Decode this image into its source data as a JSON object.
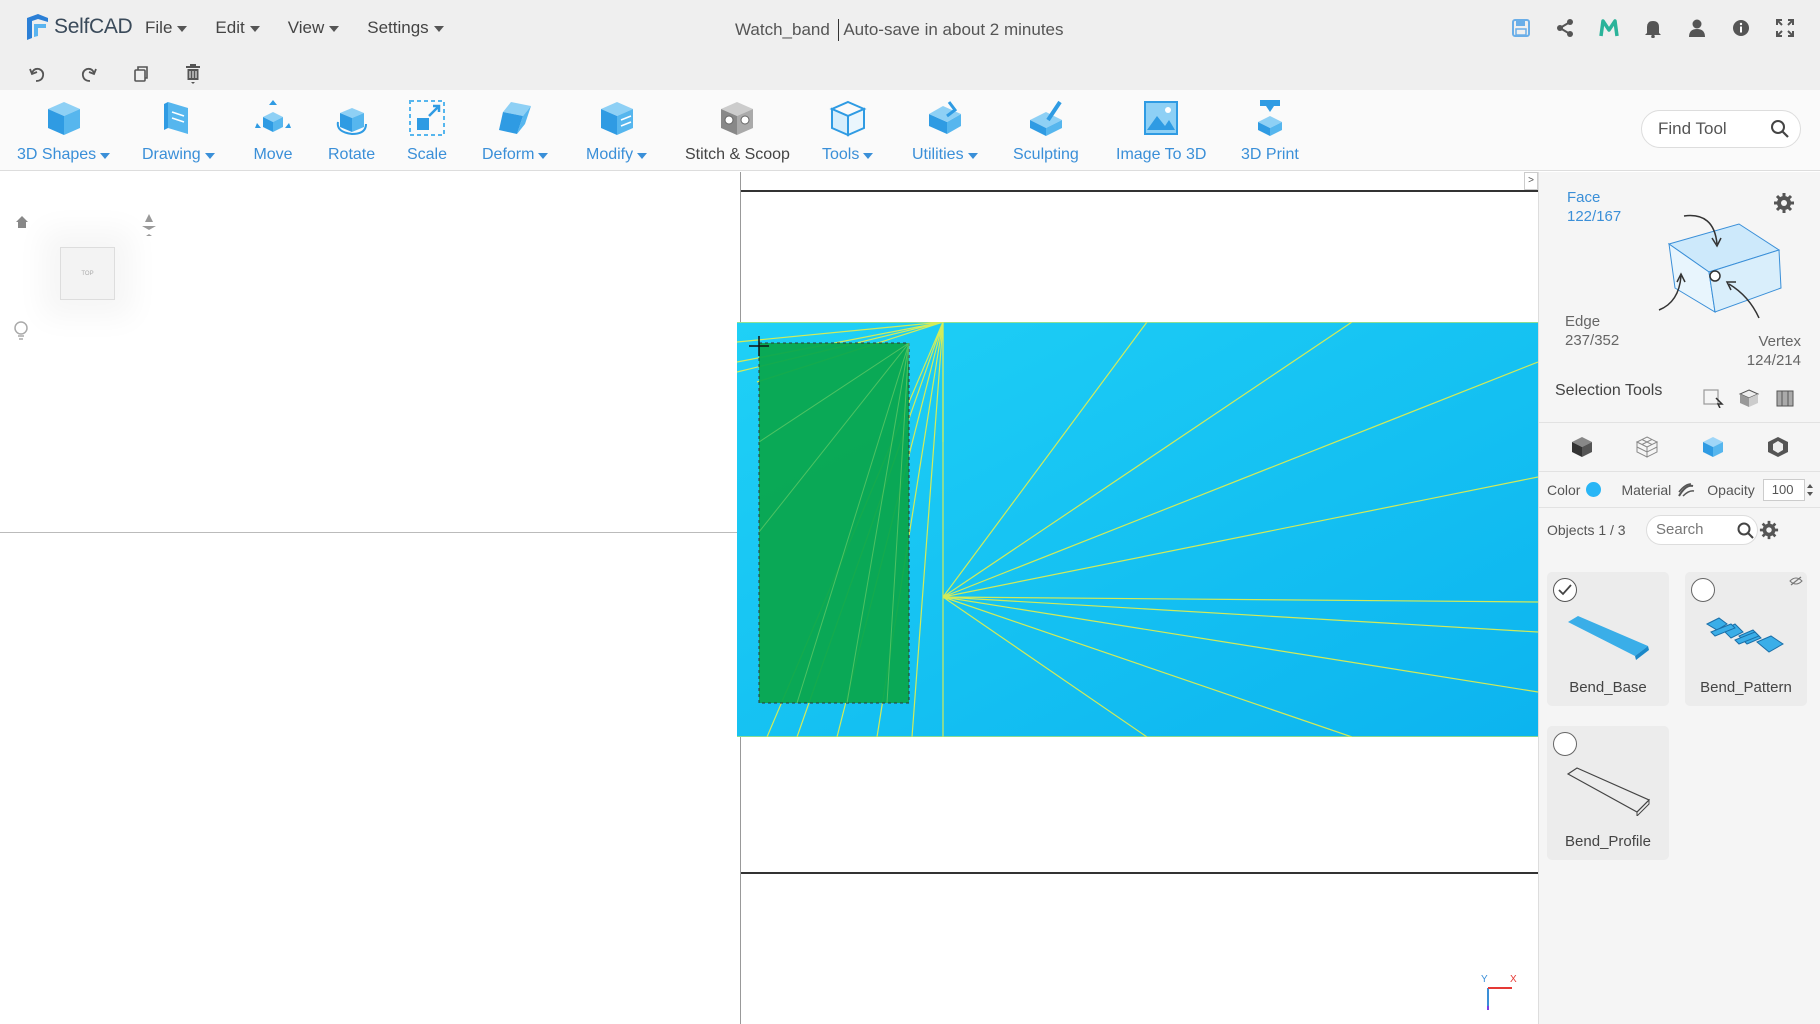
{
  "app": {
    "name": "SelfCAD",
    "menu": [
      "File",
      "Edit",
      "View",
      "Settings"
    ],
    "document_name": "Watch_band",
    "autosave_status": "Auto-save in about 2 minutes"
  },
  "topbar_icons": [
    "save-icon",
    "share-icon",
    "m-logo-icon",
    "bell-icon",
    "user-icon",
    "info-icon",
    "fullscreen-icon"
  ],
  "undo_row": [
    "undo-icon",
    "redo-icon",
    "copy-icon",
    "delete-icon"
  ],
  "toolbar": {
    "tools": [
      {
        "label": "3D Shapes",
        "dropdown": true
      },
      {
        "label": "Drawing",
        "dropdown": true
      },
      {
        "label": "Move",
        "dropdown": false
      },
      {
        "label": "Rotate",
        "dropdown": false
      },
      {
        "label": "Scale",
        "dropdown": false
      },
      {
        "label": "Deform",
        "dropdown": true
      },
      {
        "label": "Modify",
        "dropdown": true
      },
      {
        "label": "Stitch & Scoop",
        "dropdown": false
      },
      {
        "label": "Tools",
        "dropdown": true
      },
      {
        "label": "Utilities",
        "dropdown": true
      },
      {
        "label": "Sculpting",
        "dropdown": false
      },
      {
        "label": "Image To 3D",
        "dropdown": false
      },
      {
        "label": "3D Print",
        "dropdown": false
      }
    ],
    "find_tool_placeholder": "Find Tool"
  },
  "viewport": {
    "viewcube_label": "TOP",
    "collapse_glyph": ">"
  },
  "selection_panel": {
    "face_label": "Face",
    "face_count": "122/167",
    "edge_label": "Edge",
    "edge_count": "237/352",
    "vertex_label": "Vertex",
    "vertex_count": "124/214",
    "selection_tools_title": "Selection Tools"
  },
  "properties": {
    "color_label": "Color",
    "color_value": "#29b6f6",
    "material_label": "Material",
    "opacity_label": "Opacity",
    "opacity_value": "100"
  },
  "objects": {
    "count_label": "Objects 1 / 3",
    "search_placeholder": "Search",
    "items": [
      {
        "name": "Bend_Base",
        "selected": true
      },
      {
        "name": "Bend_Pattern",
        "selected": false,
        "hidden": true
      },
      {
        "name": "Bend_Profile",
        "selected": false
      }
    ]
  },
  "colors": {
    "accent": "#3a8fd8",
    "model_cyan": "#16c3f2",
    "selection_green": "#0aa64d",
    "wire_yellow": "#e6f04a"
  }
}
